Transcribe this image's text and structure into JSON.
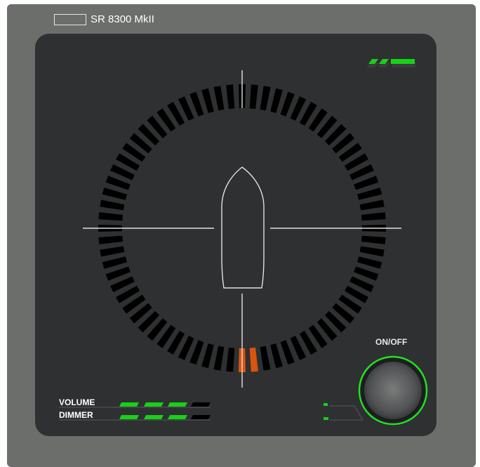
{
  "device": {
    "title": "SR 8300 MkII"
  },
  "controls": {
    "onoff_label": "ON/OFF",
    "volume_label": "VOLUME",
    "dimmer_label": "DIMMER",
    "volume_level": 3,
    "dimmer_level": 3,
    "level_max": 4
  },
  "compass": {
    "segment_count": 72,
    "highlighted_segments": [
      35,
      36
    ],
    "colors": {
      "segment": "#000000",
      "highlight": "#d9540f",
      "crosshair": "#e0e0e0",
      "boat_outline": "#e0e0e0"
    }
  },
  "colors": {
    "led_on": "#16d216",
    "led_off": "#000000",
    "knob_ring": "#22e022"
  }
}
